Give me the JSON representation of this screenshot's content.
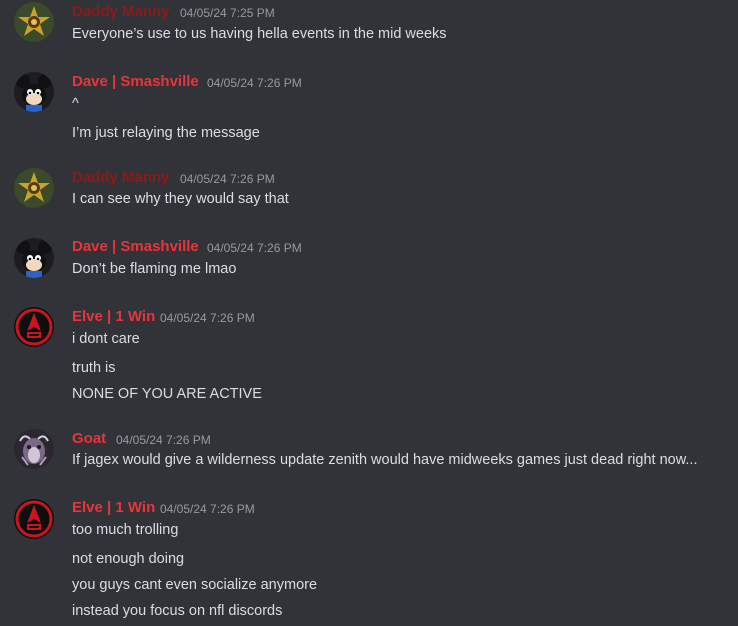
{
  "messages": [
    {
      "author": "Daddy Manny",
      "author_color": "#8b1a1a",
      "timestamp": "04/05/24 7:25 PM",
      "avatar_icon": "gold-crest-avatar",
      "lines": [
        "Everyone’s use to us having hella events in the mid weeks"
      ]
    },
    {
      "author": "Dave | Smashville",
      "author_color": "#e8343a",
      "timestamp": "04/05/24 7:26 PM",
      "avatar_icon": "cartoon-mouse-avatar",
      "lines": [
        "^",
        "I’m just relaying the message"
      ]
    },
    {
      "author": "Daddy Manny",
      "author_color": "#8b1a1a",
      "timestamp": "04/05/24 7:26 PM",
      "avatar_icon": "gold-crest-avatar",
      "lines": [
        "I can see why they would say that"
      ]
    },
    {
      "author": "Dave | Smashville",
      "author_color": "#e8343a",
      "timestamp": "04/05/24 7:26 PM",
      "avatar_icon": "cartoon-mouse-avatar",
      "lines": [
        "Don’t be flaming me lmao"
      ]
    },
    {
      "author": "Elve | 1 Win",
      "author_color": "#e8343a",
      "timestamp": "04/05/24 7:26 PM",
      "avatar_icon": "red-emblem-avatar",
      "lines": [
        "i dont care",
        "truth is",
        "NONE OF YOU ARE ACTIVE"
      ]
    },
    {
      "author": "Goat",
      "author_color": "#e8343a",
      "timestamp": "04/05/24 7:26 PM",
      "avatar_icon": "goat-avatar",
      "lines": [
        "If jagex would give a wilderness update zenith would have midweeks games just dead right now..."
      ]
    },
    {
      "author": "Elve | 1 Win",
      "author_color": "#e8343a",
      "timestamp": "04/05/24 7:26 PM",
      "avatar_icon": "red-emblem-avatar",
      "lines": [
        "too much trolling",
        "not enough doing",
        "you guys cant even socialize anymore",
        "instead you focus on nfl discords"
      ]
    }
  ]
}
